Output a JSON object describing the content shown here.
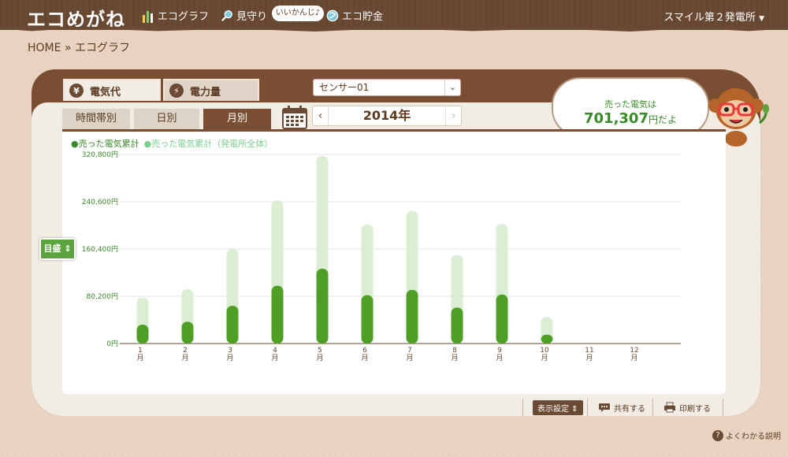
{
  "header": {
    "logo": "エコめがね",
    "nav": [
      {
        "label": "エコグラフ",
        "icon": "bar-chart-icon"
      },
      {
        "label": "見守り",
        "icon": "magnifier-icon"
      },
      {
        "label": "エコ貯金",
        "icon": "yen-coin-icon"
      }
    ],
    "bubble": "いいかんじ♪",
    "plant": "スマイル第２発電所",
    "plant_icon": "caret-down-icon"
  },
  "breadcrumb": {
    "home": "HOME",
    "sep": "»",
    "current": "エコグラフ"
  },
  "tabs": [
    {
      "label": "電気代",
      "icon": "¥",
      "active": true
    },
    {
      "label": "電力量",
      "icon": "⚡",
      "active": false
    }
  ],
  "sensor": {
    "value": "センサー01",
    "arrow": "⌄"
  },
  "speech": {
    "line1": "売った電気は",
    "amount": "701,307",
    "suffix": "円だよ"
  },
  "period_tabs": [
    {
      "label": "時間帯別",
      "active": false
    },
    {
      "label": "日別",
      "active": false
    },
    {
      "label": "月別",
      "active": true
    }
  ],
  "year": {
    "label": "2014年",
    "prev": "‹",
    "next": "›"
  },
  "legend": {
    "series1": "●売った電気累計",
    "series2": "●売った電気累計（発電所全体）"
  },
  "unit_button": "目盛 ⇕",
  "chart_data": {
    "type": "bar",
    "categories": [
      "1",
      "2",
      "3",
      "4",
      "5",
      "6",
      "7",
      "8",
      "9",
      "10",
      "11",
      "12"
    ],
    "category_suffix": "月",
    "series": [
      {
        "name": "売った電気累計",
        "color": "#4f9e25",
        "values": [
          32000,
          37000,
          64000,
          98000,
          127000,
          82000,
          91000,
          61000,
          83000,
          15000,
          0,
          0
        ]
      },
      {
        "name": "売った電気累計（発電所全体）",
        "color": "#dbeed3",
        "values": [
          78000,
          92000,
          160000,
          243000,
          318000,
          202000,
          225000,
          150000,
          203000,
          45000,
          0,
          0
        ]
      }
    ],
    "yticks": [
      "0円",
      "80,200円",
      "160,400円",
      "240,600円",
      "320,800円"
    ],
    "ylim": [
      0,
      320800
    ],
    "grid": true
  },
  "footer": {
    "display_settings": "表示設定 ⇕",
    "share": "共有する",
    "print": "印刷する"
  },
  "help": {
    "label": "よくわかる説明"
  }
}
